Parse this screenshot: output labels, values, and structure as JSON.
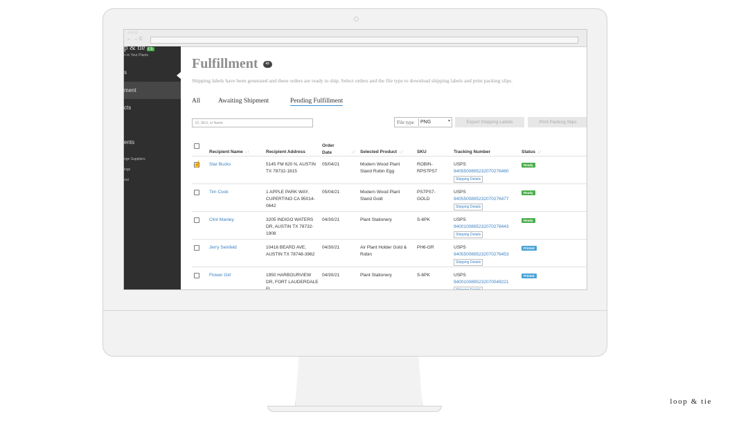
{
  "app": {
    "logo_text": "p & tie",
    "logo_badge": "Cb",
    "tagline": "n to Your Plants",
    "sidebar": [
      {
        "label": "s"
      },
      {
        "label": "ment"
      },
      {
        "label": "cts"
      },
      {
        "label": "ents"
      }
    ],
    "sidebar_sub": [
      "nge Suppliers",
      "ings",
      "out"
    ]
  },
  "page": {
    "title": "Fulfillment",
    "count": "43",
    "subtitle": "Shipping labels have been generated and these orders are ready to ship. Select orders and the file type to download shipping labels and print packing slips.",
    "tabs": [
      "All",
      "Awaiting Shipment",
      "Pending Fulfillment"
    ],
    "active_tab": "Pending Fulfillment",
    "search_placeholder": "ID, SKU, or Name",
    "file_type_label": "File type",
    "file_type_value": "PNG",
    "export_button": "Export Shipping Labels",
    "print_button": "Print Packing Slips"
  },
  "table": {
    "headers": [
      "Recipient Name",
      "Recipient Address",
      "Order Date",
      "Selected Product",
      "SKU",
      "Tracking Number",
      "Status"
    ],
    "shipping_details_label": "Shipping Details",
    "rows": [
      {
        "name": "Star Bucks",
        "address": "5145 FM 620 N, AUSTIN TX 78732-1815",
        "date": "05/04/21",
        "product": "Modern Wood Plant Stand Robin Egg",
        "sku": "ROBIN-RPS7PS7",
        "carrier": "USPS",
        "tracking": "9405500895232070276460",
        "status": "Ready"
      },
      {
        "name": "Tim Cook",
        "address": "1 APPLE PARK WAY, CUPERTINO CA 95014-0642",
        "date": "05/04/21",
        "product": "Modern Wood Plant Stand Gold",
        "sku": "PS7PS7-GOLD",
        "carrier": "USPS",
        "tracking": "9405500895232070276477",
        "status": "Ready"
      },
      {
        "name": "Clint Manley",
        "address": "3205 INDIGO WATERS DR, AUSTIN TX 78732-1908",
        "date": "04/30/21",
        "product": "Plant Stationery",
        "sku": "S-6PK",
        "carrier": "USPS",
        "tracking": "9400100895232070276443",
        "status": "Ready"
      },
      {
        "name": "Jerry Seinfeld",
        "address": "10416 BEARD AVE, AUSTIN TX 78748-3962",
        "date": "04/30/21",
        "product": "Air Plant Holder Gold & Robin",
        "sku": "PH6-GR",
        "carrier": "USPS",
        "tracking": "9405500895232070276453",
        "status": "Printed"
      },
      {
        "name": "Flower Girl",
        "address": "1950 HARBOURVIEW DR, FORT LAUDERDALE FL",
        "date": "04/30/21",
        "product": "Plant Stationery",
        "sku": "S-6PK",
        "carrier": "USPS",
        "tracking": "9400100895232070049221",
        "status": "Printed"
      }
    ]
  },
  "brand": "loop & tie",
  "colors": {
    "ready": "#4cae4c",
    "printed": "#4aa3d6",
    "link": "#3a7fc1",
    "sidebar": "#2f2f2f"
  }
}
